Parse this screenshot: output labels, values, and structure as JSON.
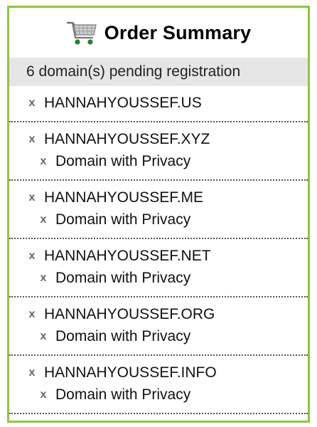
{
  "header": {
    "title": "Order Summary",
    "icon": "shopping-cart-icon"
  },
  "pending": {
    "text": "6 domain(s) pending registration"
  },
  "remove_glyph": "x",
  "accent_color": "#8cc641",
  "items": [
    {
      "domain": "HANNAHYOUSSEF.US",
      "addons": []
    },
    {
      "domain": "HANNAHYOUSSEF.XYZ",
      "addons": [
        "Domain with Privacy"
      ]
    },
    {
      "domain": "HANNAHYOUSSEF.ME",
      "addons": [
        "Domain with Privacy"
      ]
    },
    {
      "domain": "HANNAHYOUSSEF.NET",
      "addons": [
        "Domain with Privacy"
      ]
    },
    {
      "domain": "HANNAHYOUSSEF.ORG",
      "addons": [
        "Domain with Privacy"
      ]
    },
    {
      "domain": "HANNAHYOUSSEF.INFO",
      "addons": [
        "Domain with Privacy"
      ]
    }
  ]
}
